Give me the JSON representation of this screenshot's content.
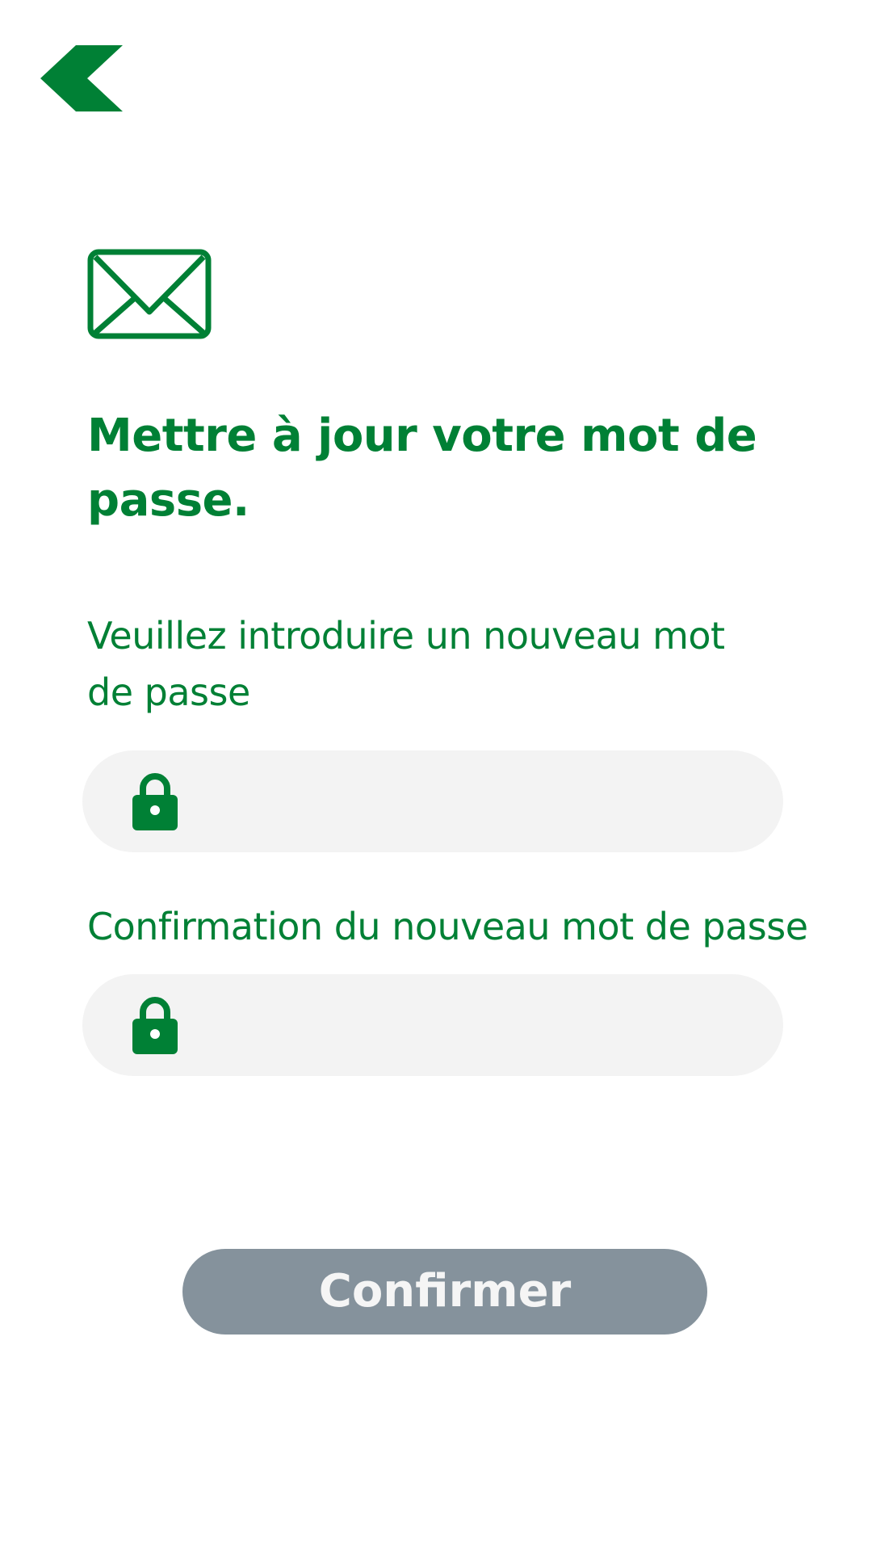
{
  "colors": {
    "brand_green": "#008035",
    "field_background": "#f3f3f3",
    "button_disabled": "#85929c",
    "button_text": "#f5f5f5",
    "background": "#ffffff"
  },
  "header": {
    "back_icon": "chevron-left-icon"
  },
  "main": {
    "hero_icon": "envelope-icon",
    "title": "Mettre à jour votre mot de passe.",
    "new_password": {
      "label": "Veuillez introduire un nouveau mot de passe",
      "icon": "lock-icon",
      "value": "",
      "placeholder": ""
    },
    "confirm_password": {
      "label": "Confirmation du nouveau mot de passe",
      "icon": "lock-icon",
      "value": "",
      "placeholder": ""
    },
    "confirm_button": {
      "label": "Confirmer",
      "state": "disabled"
    }
  }
}
